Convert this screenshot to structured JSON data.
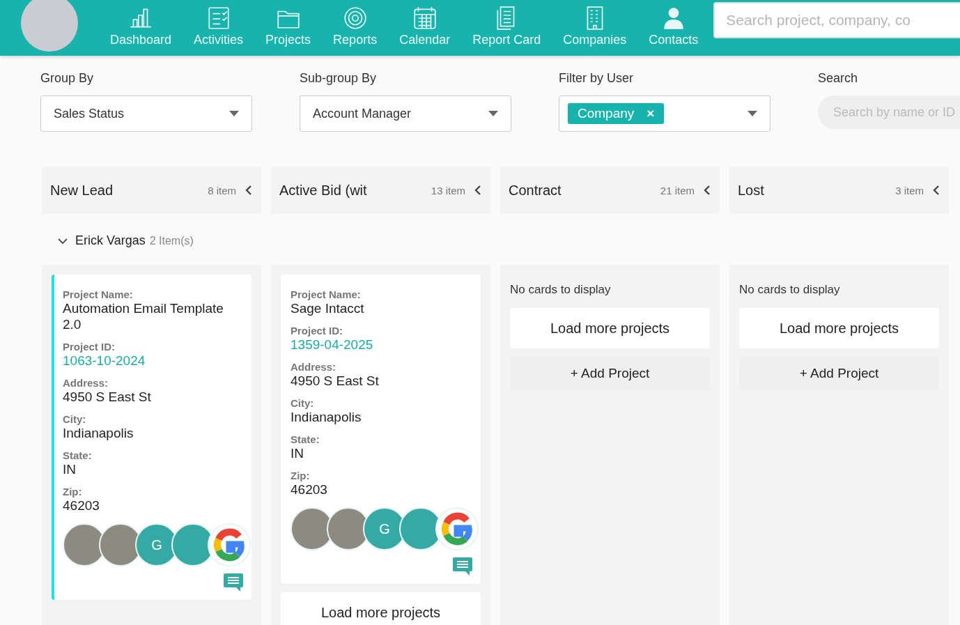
{
  "nav": {
    "items": [
      {
        "label": "Dashboard",
        "kind": "chart"
      },
      {
        "label": "Activities",
        "kind": "checklist"
      },
      {
        "label": "Projects",
        "kind": "folder"
      },
      {
        "label": "Reports",
        "kind": "target"
      },
      {
        "label": "Calendar",
        "kind": "calendar"
      },
      {
        "label": "Report Card",
        "kind": "document"
      },
      {
        "label": "Companies",
        "kind": "building"
      },
      {
        "label": "Contacts",
        "kind": "person"
      }
    ],
    "search": {
      "placeholder": "Search project, company, co"
    }
  },
  "filters": [
    {
      "label": "Group By",
      "kind": "select",
      "value": "Sales Status"
    },
    {
      "label": "Sub-group By",
      "kind": "select",
      "value": "Account Manager"
    },
    {
      "label": "Filter by User",
      "kind": "tags",
      "tags": [
        "Company"
      ],
      "remove": "×"
    },
    {
      "label": "Search",
      "kind": "search",
      "placeholder": "Search by name or ID"
    }
  ],
  "columns": [
    {
      "title": "New Lead",
      "count": "8 item"
    },
    {
      "title": "Active Bid (wit",
      "count": "13 item"
    },
    {
      "title": "Contract",
      "count": "21 item"
    },
    {
      "title": "Lost",
      "count": "3 item"
    }
  ],
  "group": {
    "name": "Erick Vargas",
    "count": "2 Item(s)",
    "expanded": true
  },
  "lanes": [
    {
      "cards": [
        {
          "highlighted": true,
          "fields": [
            {
              "label": "Project Name:",
              "value": "Automation Email Template 2.0",
              "kind": "text"
            },
            {
              "label": "Project ID:",
              "value": "1063-10-2024",
              "kind": "link"
            },
            {
              "label": "Address:",
              "value": "4950 S East St",
              "kind": "text"
            },
            {
              "label": "City:",
              "value": "Indianapolis",
              "kind": "text"
            },
            {
              "label": "State:",
              "value": "IN",
              "kind": "text"
            },
            {
              "label": "Zip:",
              "value": "46203",
              "kind": "text"
            }
          ],
          "avatars": [
            {
              "kind": "photo"
            },
            {
              "kind": "photo"
            },
            {
              "kind": "letter",
              "text": "G"
            },
            {
              "kind": "blank"
            },
            {
              "kind": "logo"
            }
          ]
        }
      ]
    },
    {
      "cards": [
        {
          "highlighted": false,
          "fields": [
            {
              "label": "Project Name:",
              "value": "Sage Intacct",
              "kind": "text"
            },
            {
              "label": "Project ID:",
              "value": "1359-04-2025",
              "kind": "link"
            },
            {
              "label": "Address:",
              "value": "4950 S East St",
              "kind": "text"
            },
            {
              "label": "City:",
              "value": "Indianapolis",
              "kind": "text"
            },
            {
              "label": "State:",
              "value": "IN",
              "kind": "text"
            },
            {
              "label": "Zip:",
              "value": "46203",
              "kind": "text"
            }
          ],
          "avatars": [
            {
              "kind": "photo"
            },
            {
              "kind": "photo"
            },
            {
              "kind": "letter",
              "text": "G"
            },
            {
              "kind": "blank"
            },
            {
              "kind": "logo"
            }
          ]
        }
      ],
      "buttons": [
        {
          "label": "Load more projects",
          "kind": "load"
        }
      ]
    },
    {
      "empty": "No cards to display",
      "buttons": [
        {
          "label": "Load more projects",
          "kind": "load"
        },
        {
          "label": "+ Add Project",
          "kind": "add"
        }
      ]
    },
    {
      "empty": "No cards to display",
      "buttons": [
        {
          "label": "Load more projects",
          "kind": "load"
        },
        {
          "label": "+ Add Project",
          "kind": "add"
        }
      ]
    }
  ]
}
